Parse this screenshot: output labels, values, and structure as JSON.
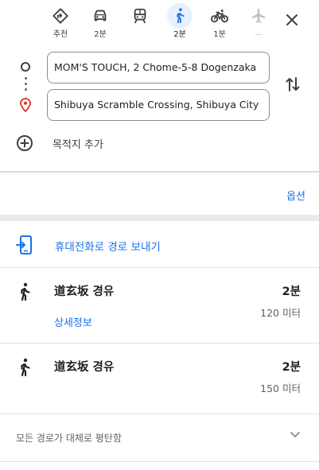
{
  "travel_modes": [
    {
      "name": "best",
      "label": "추천",
      "icon": "best-route-icon",
      "active": false
    },
    {
      "name": "driving",
      "label": "2분",
      "icon": "car-icon",
      "active": false
    },
    {
      "name": "transit",
      "label": "",
      "icon": "train-icon",
      "active": false
    },
    {
      "name": "walking",
      "label": "2분",
      "icon": "walk-icon",
      "active": true
    },
    {
      "name": "cycling",
      "label": "1분",
      "icon": "bicycle-icon",
      "active": false
    },
    {
      "name": "flight",
      "label": "—",
      "icon": "airplane-icon",
      "active": false
    }
  ],
  "waypoints": {
    "origin": "MOM'S TOUCH, 2 Chome-5-8 Dogenzaka",
    "destination": "Shibuya Scramble Crossing, Shibuya City"
  },
  "add_destination_label": "목적지 추가",
  "options_label": "옵션",
  "send_to_phone_label": "휴대전화로 경로 보내기",
  "routes": [
    {
      "via": "道玄坂 경유",
      "time": "2분",
      "distance": "120 미터",
      "details_label": "상세정보"
    },
    {
      "via": "道玄坂 경유",
      "time": "2분",
      "distance": "150 미터"
    }
  ],
  "terrain_note": "모든 경로가 대체로 평탄함",
  "colors": {
    "accent": "#1a73e8",
    "active_bg": "#e8f0fe",
    "text": "#202124",
    "muted": "#5f6368"
  }
}
